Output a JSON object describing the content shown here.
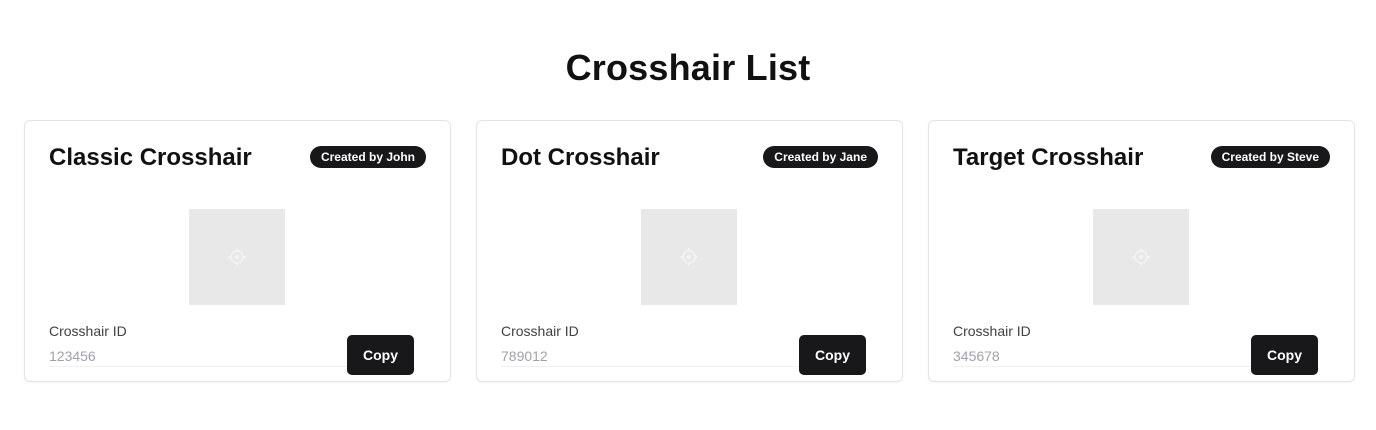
{
  "page": {
    "title": "Crosshair List"
  },
  "cards": [
    {
      "title": "Classic Crosshair",
      "badge": "Created by John",
      "id_label": "Crosshair ID",
      "id_value": "123456",
      "copy_label": "Copy"
    },
    {
      "title": "Dot Crosshair",
      "badge": "Created by Jane",
      "id_label": "Crosshair ID",
      "id_value": "789012",
      "copy_label": "Copy"
    },
    {
      "title": "Target Crosshair",
      "badge": "Created by Steve",
      "id_label": "Crosshair ID",
      "id_value": "345678",
      "copy_label": "Copy"
    }
  ],
  "icons": {
    "preview": "crosshair-preview-icon"
  },
  "colors": {
    "badge_bg": "#18181b",
    "button_bg": "#18181b",
    "preview_bg": "#e8e8e8",
    "border": "#e4e4e7"
  }
}
